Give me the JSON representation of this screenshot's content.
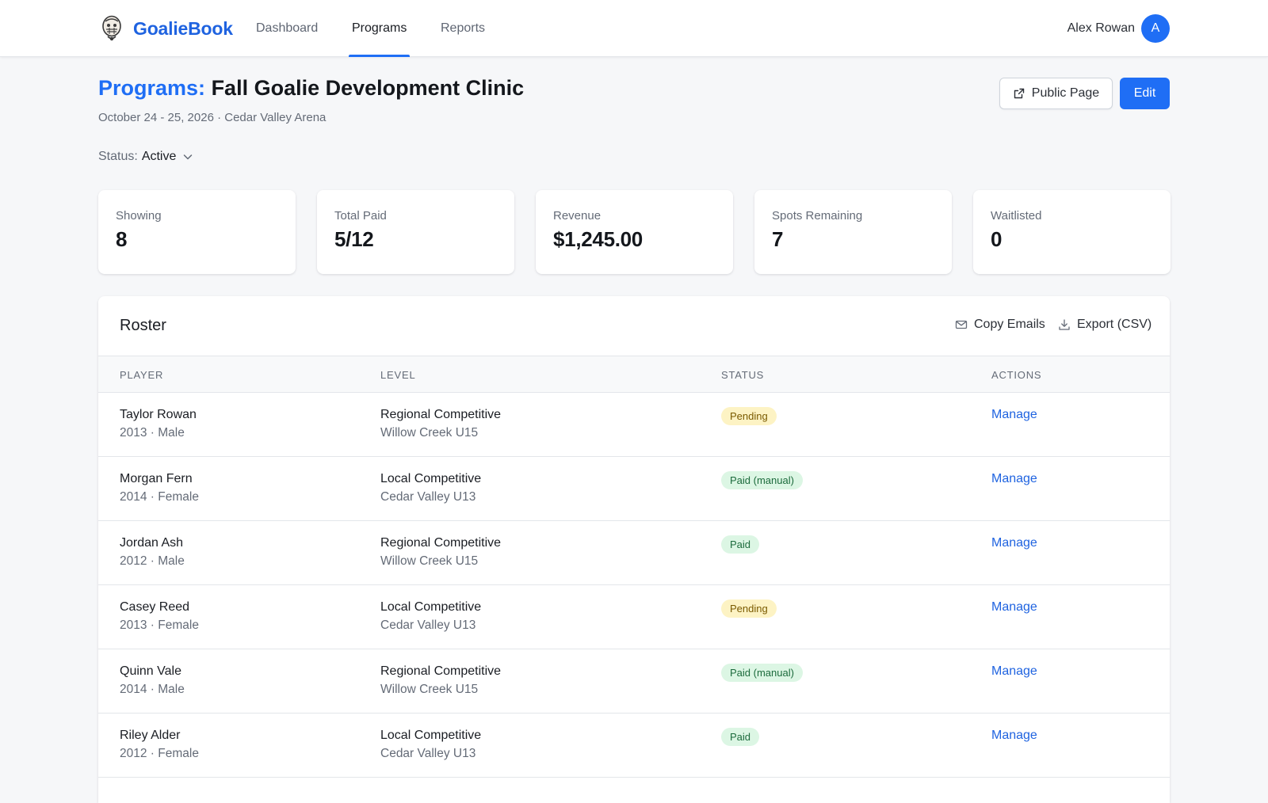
{
  "nav": {
    "brand": "GoalieBook",
    "links": [
      {
        "label": "Dashboard",
        "active": false
      },
      {
        "label": "Programs",
        "active": true
      },
      {
        "label": "Reports",
        "active": false
      }
    ],
    "user_name": "Alex Rowan",
    "avatar_initial": "A"
  },
  "header": {
    "crumb": "Programs:",
    "title": "Fall Goalie Development Clinic",
    "subtitle": "October 24 - 25, 2026 · Cedar Valley Arena",
    "status_label": "Status:",
    "status_value": "Active",
    "public_page_label": "Public Page",
    "edit_label": "Edit"
  },
  "stats": [
    {
      "label": "Showing",
      "value": "8"
    },
    {
      "label": "Total Paid",
      "value": "5/12"
    },
    {
      "label": "Revenue",
      "value": "$1,245.00"
    },
    {
      "label": "Spots Remaining",
      "value": "7"
    },
    {
      "label": "Waitlisted",
      "value": "0"
    }
  ],
  "roster": {
    "title": "Roster",
    "copy_emails_label": "Copy Emails",
    "export_label": "Export (CSV)",
    "columns": [
      "PLAYER",
      "LEVEL",
      "STATUS",
      "ACTIONS"
    ],
    "rows": [
      {
        "name": "Taylor Rowan",
        "meta": "2013 · Male",
        "level": "Regional Competitive",
        "team": "Willow Creek U15",
        "status": "Pending",
        "status_kind": "pending",
        "action": "Manage"
      },
      {
        "name": "Morgan Fern",
        "meta": "2014 · Female",
        "level": "Local Competitive",
        "team": "Cedar Valley U13",
        "status": "Paid (manual)",
        "status_kind": "paid",
        "action": "Manage"
      },
      {
        "name": "Jordan Ash",
        "meta": "2012 · Male",
        "level": "Regional Competitive",
        "team": "Willow Creek U15",
        "status": "Paid",
        "status_kind": "paid",
        "action": "Manage"
      },
      {
        "name": "Casey Reed",
        "meta": "2013 · Female",
        "level": "Local Competitive",
        "team": "Cedar Valley U13",
        "status": "Pending",
        "status_kind": "pending",
        "action": "Manage"
      },
      {
        "name": "Quinn Vale",
        "meta": "2014 · Male",
        "level": "Regional Competitive",
        "team": "Willow Creek U15",
        "status": "Paid (manual)",
        "status_kind": "paid",
        "action": "Manage"
      },
      {
        "name": "Riley Alder",
        "meta": "2012 · Female",
        "level": "Local Competitive",
        "team": "Cedar Valley U13",
        "status": "Paid",
        "status_kind": "paid",
        "action": "Manage"
      }
    ]
  },
  "colors": {
    "accent": "#1f6ef5",
    "brand": "#1f63e0",
    "pending_bg": "#fdf3c4",
    "paid_bg": "#dcf6e4"
  },
  "icons": [
    "goalie-mask-logo-icon",
    "chevron-down-icon",
    "external-link-icon",
    "mail-icon",
    "download-icon"
  ]
}
